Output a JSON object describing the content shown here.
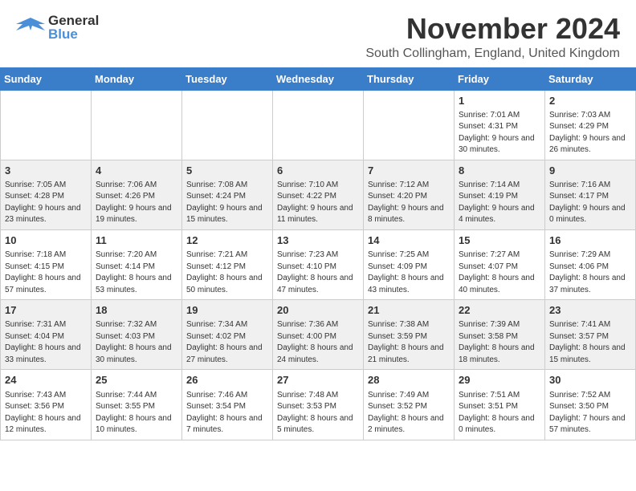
{
  "header": {
    "logo": {
      "general": "General",
      "blue": "Blue"
    },
    "title": "November 2024",
    "location": "South Collingham, England, United Kingdom"
  },
  "calendar": {
    "weekdays": [
      "Sunday",
      "Monday",
      "Tuesday",
      "Wednesday",
      "Thursday",
      "Friday",
      "Saturday"
    ],
    "weeks": [
      [
        {
          "day": "",
          "info": ""
        },
        {
          "day": "",
          "info": ""
        },
        {
          "day": "",
          "info": ""
        },
        {
          "day": "",
          "info": ""
        },
        {
          "day": "",
          "info": ""
        },
        {
          "day": "1",
          "info": "Sunrise: 7:01 AM\nSunset: 4:31 PM\nDaylight: 9 hours and 30 minutes."
        },
        {
          "day": "2",
          "info": "Sunrise: 7:03 AM\nSunset: 4:29 PM\nDaylight: 9 hours and 26 minutes."
        }
      ],
      [
        {
          "day": "3",
          "info": "Sunrise: 7:05 AM\nSunset: 4:28 PM\nDaylight: 9 hours and 23 minutes."
        },
        {
          "day": "4",
          "info": "Sunrise: 7:06 AM\nSunset: 4:26 PM\nDaylight: 9 hours and 19 minutes."
        },
        {
          "day": "5",
          "info": "Sunrise: 7:08 AM\nSunset: 4:24 PM\nDaylight: 9 hours and 15 minutes."
        },
        {
          "day": "6",
          "info": "Sunrise: 7:10 AM\nSunset: 4:22 PM\nDaylight: 9 hours and 11 minutes."
        },
        {
          "day": "7",
          "info": "Sunrise: 7:12 AM\nSunset: 4:20 PM\nDaylight: 9 hours and 8 minutes."
        },
        {
          "day": "8",
          "info": "Sunrise: 7:14 AM\nSunset: 4:19 PM\nDaylight: 9 hours and 4 minutes."
        },
        {
          "day": "9",
          "info": "Sunrise: 7:16 AM\nSunset: 4:17 PM\nDaylight: 9 hours and 0 minutes."
        }
      ],
      [
        {
          "day": "10",
          "info": "Sunrise: 7:18 AM\nSunset: 4:15 PM\nDaylight: 8 hours and 57 minutes."
        },
        {
          "day": "11",
          "info": "Sunrise: 7:20 AM\nSunset: 4:14 PM\nDaylight: 8 hours and 53 minutes."
        },
        {
          "day": "12",
          "info": "Sunrise: 7:21 AM\nSunset: 4:12 PM\nDaylight: 8 hours and 50 minutes."
        },
        {
          "day": "13",
          "info": "Sunrise: 7:23 AM\nSunset: 4:10 PM\nDaylight: 8 hours and 47 minutes."
        },
        {
          "day": "14",
          "info": "Sunrise: 7:25 AM\nSunset: 4:09 PM\nDaylight: 8 hours and 43 minutes."
        },
        {
          "day": "15",
          "info": "Sunrise: 7:27 AM\nSunset: 4:07 PM\nDaylight: 8 hours and 40 minutes."
        },
        {
          "day": "16",
          "info": "Sunrise: 7:29 AM\nSunset: 4:06 PM\nDaylight: 8 hours and 37 minutes."
        }
      ],
      [
        {
          "day": "17",
          "info": "Sunrise: 7:31 AM\nSunset: 4:04 PM\nDaylight: 8 hours and 33 minutes."
        },
        {
          "day": "18",
          "info": "Sunrise: 7:32 AM\nSunset: 4:03 PM\nDaylight: 8 hours and 30 minutes."
        },
        {
          "day": "19",
          "info": "Sunrise: 7:34 AM\nSunset: 4:02 PM\nDaylight: 8 hours and 27 minutes."
        },
        {
          "day": "20",
          "info": "Sunrise: 7:36 AM\nSunset: 4:00 PM\nDaylight: 8 hours and 24 minutes."
        },
        {
          "day": "21",
          "info": "Sunrise: 7:38 AM\nSunset: 3:59 PM\nDaylight: 8 hours and 21 minutes."
        },
        {
          "day": "22",
          "info": "Sunrise: 7:39 AM\nSunset: 3:58 PM\nDaylight: 8 hours and 18 minutes."
        },
        {
          "day": "23",
          "info": "Sunrise: 7:41 AM\nSunset: 3:57 PM\nDaylight: 8 hours and 15 minutes."
        }
      ],
      [
        {
          "day": "24",
          "info": "Sunrise: 7:43 AM\nSunset: 3:56 PM\nDaylight: 8 hours and 12 minutes."
        },
        {
          "day": "25",
          "info": "Sunrise: 7:44 AM\nSunset: 3:55 PM\nDaylight: 8 hours and 10 minutes."
        },
        {
          "day": "26",
          "info": "Sunrise: 7:46 AM\nSunset: 3:54 PM\nDaylight: 8 hours and 7 minutes."
        },
        {
          "day": "27",
          "info": "Sunrise: 7:48 AM\nSunset: 3:53 PM\nDaylight: 8 hours and 5 minutes."
        },
        {
          "day": "28",
          "info": "Sunrise: 7:49 AM\nSunset: 3:52 PM\nDaylight: 8 hours and 2 minutes."
        },
        {
          "day": "29",
          "info": "Sunrise: 7:51 AM\nSunset: 3:51 PM\nDaylight: 8 hours and 0 minutes."
        },
        {
          "day": "30",
          "info": "Sunrise: 7:52 AM\nSunset: 3:50 PM\nDaylight: 7 hours and 57 minutes."
        }
      ]
    ]
  }
}
